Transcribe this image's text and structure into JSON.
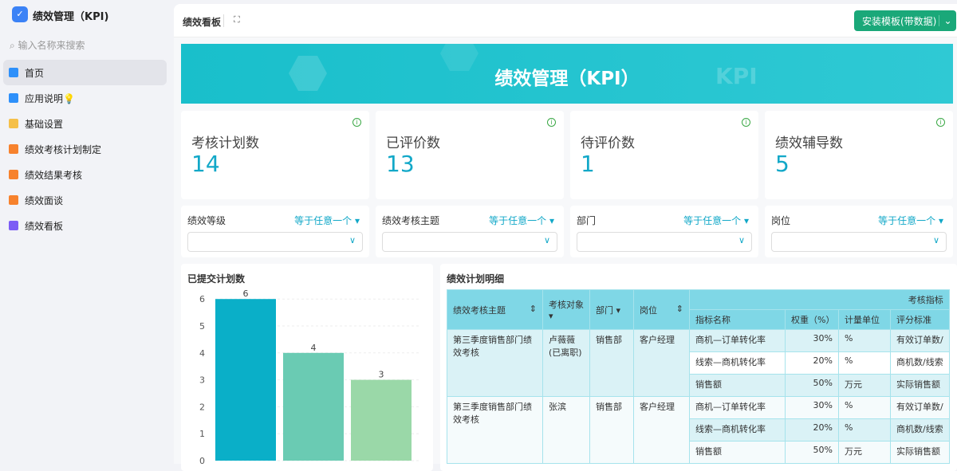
{
  "sidebar": {
    "app_title": "绩效管理（KPI)",
    "search_placeholder": "输入名称来搜索",
    "items": [
      {
        "label": "首页",
        "icon": "home-icon",
        "color": "#2e90fa"
      },
      {
        "label": "应用说明💡",
        "icon": "doc-icon",
        "color": "#2e90fa"
      },
      {
        "label": "基础设置",
        "icon": "folder-icon",
        "color": "#f5c04a"
      },
      {
        "label": "绩效考核计划制定",
        "icon": "org-icon",
        "color": "#f7822d"
      },
      {
        "label": "绩效结果考核",
        "icon": "org-icon",
        "color": "#f7822d"
      },
      {
        "label": "绩效面谈",
        "icon": "org-icon",
        "color": "#f7822d"
      },
      {
        "label": "绩效看板",
        "icon": "chart-icon",
        "color": "#7c5cf5"
      }
    ]
  },
  "header": {
    "title": "绩效看板",
    "install_label": "安装模板(带数据)"
  },
  "banner": {
    "title": "绩效管理（KPI）",
    "watermark": "KPI"
  },
  "stats": [
    {
      "label": "考核计划数",
      "value": "14"
    },
    {
      "label": "已评价数",
      "value": "13"
    },
    {
      "label": "待评价数",
      "value": "1"
    },
    {
      "label": "绩效辅导数",
      "value": "5"
    }
  ],
  "filters": [
    {
      "label": "绩效等级",
      "op": "等于任意一个"
    },
    {
      "label": "绩效考核主题",
      "op": "等于任意一个"
    },
    {
      "label": "部门",
      "op": "等于任意一个"
    },
    {
      "label": "岗位",
      "op": "等于任意一个"
    }
  ],
  "chart_data": {
    "type": "bar",
    "title": "已提交计划数",
    "categories": [
      "",
      "",
      ""
    ],
    "values": [
      6,
      4,
      3
    ],
    "colors": [
      "#0aafc8",
      "#6acbb3",
      "#9ad8a8"
    ],
    "ylim": [
      0,
      6
    ],
    "yticks": [
      0,
      1,
      2,
      3,
      4,
      5,
      6
    ]
  },
  "table": {
    "title": "绩效计划明细",
    "headers": {
      "theme": "绩效考核主题",
      "target": "考核对象",
      "dept": "部门",
      "position": "岗位",
      "group": "考核指标",
      "name": "指标名称",
      "weight": "权重（%）",
      "unit": "计量单位",
      "standard": "评分标准"
    },
    "rows": [
      {
        "theme": "第三季度销售部门绩效考核",
        "target": "卢薇薇(已离职)",
        "dept": "销售部",
        "position": "客户经理",
        "indicators": [
          {
            "name": "商机—订单转化率",
            "weight": "30%",
            "unit": "%",
            "standard": "有效订单数/"
          },
          {
            "name": "线索—商机转化率",
            "weight": "20%",
            "unit": "%",
            "standard": "商机数/线索"
          },
          {
            "name": "销售额",
            "weight": "50%",
            "unit": "万元",
            "standard": "实际销售额"
          }
        ]
      },
      {
        "theme": "第三季度销售部门绩效考核",
        "target": "张滨",
        "dept": "销售部",
        "position": "客户经理",
        "indicators": [
          {
            "name": "商机—订单转化率",
            "weight": "30%",
            "unit": "%",
            "standard": "有效订单数/"
          },
          {
            "name": "线索—商机转化率",
            "weight": "20%",
            "unit": "%",
            "standard": "商机数/线索"
          },
          {
            "name": "销售额",
            "weight": "50%",
            "unit": "万元",
            "standard": "实际销售额"
          }
        ]
      }
    ]
  }
}
